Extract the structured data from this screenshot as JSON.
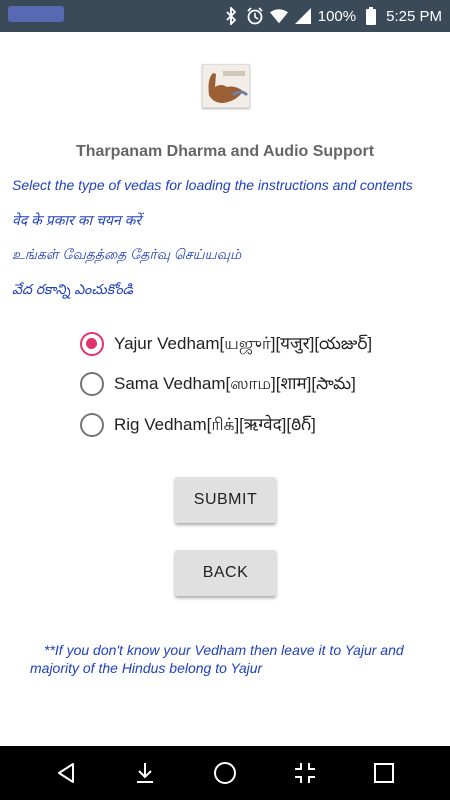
{
  "status_bar": {
    "battery": "100%",
    "time": "5:25 PM",
    "icons": [
      "bluetooth-icon",
      "alarm-icon",
      "wifi-icon",
      "signal-icon",
      "battery-icon"
    ]
  },
  "app": {
    "title": "Tharpanam Dharma and Audio Support",
    "instructions": {
      "english": "Select the type of vedas for loading the instructions and contents",
      "hindi": "वेद के प्रकार का चयन करें",
      "tamil": "உங்கள் வேதத்தை தேர்வு செய்யவும்",
      "telugu": "వేద రకాన్ని ఎంచుకోండి"
    },
    "options": [
      {
        "label": "Yajur Vedham[யஜுர்][यजुर][యజుర్]",
        "checked": true
      },
      {
        "label": "Sama Vedham[ஸாம][शाम][సామ]",
        "checked": false
      },
      {
        "label": "Rig Vedham[ரிக்][ऋग्वेद][ఠిగ్]",
        "checked": false
      }
    ],
    "submit_label": "SUBMIT",
    "back_label": "BACK",
    "note": "**If you don't know your Vedham then leave it to Yajur and majority of the Hindus belong to Yajur"
  },
  "colors": {
    "accent": "#e4326b",
    "instruction_text": "#1f3fbf",
    "status_bar": "#3a4a59",
    "nav_bar": "#000000"
  },
  "nav_bar": {
    "icons": [
      "back-icon",
      "download-icon",
      "home-icon",
      "fullscreen-exit-icon",
      "recents-icon"
    ]
  }
}
